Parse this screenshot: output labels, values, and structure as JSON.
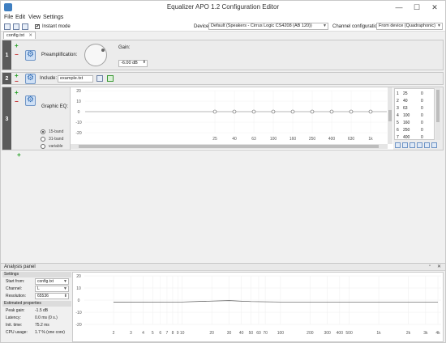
{
  "window": {
    "title": "Equalizer APO 1.2 Configuration Editor",
    "min": "—",
    "max": "☐",
    "close": "✕"
  },
  "menu": [
    "File",
    "Edit",
    "View",
    "Settings"
  ],
  "toolbar": {
    "instant_mode_label": "Instant mode",
    "instant_mode_checked": "✔",
    "device_label": "Device:",
    "device_value": "Default (Speakers - Cirrus Logic CS4208 (AB 120))",
    "channel_config_label": "Channel configuration:",
    "channel_config_value": "From device (Quadraphonic)"
  },
  "tab": {
    "label": "config.txt",
    "close": "✕"
  },
  "rows": [
    {
      "number": "1",
      "plus": "+",
      "minus": "−",
      "preamp_label": "Preamplification:",
      "gain_label": "Gain:",
      "gain_value": "-6.00 dB"
    },
    {
      "number": "2",
      "plus": "+",
      "minus": "−",
      "include_label": "Include:",
      "include_value": "example.txt"
    },
    {
      "number": "3",
      "plus": "+",
      "minus": "−",
      "eq_label": "Graphic EQ:"
    }
  ],
  "add_row": "+",
  "eq": {
    "y_ticks": [
      "20",
      "10",
      "0",
      "-10",
      "-20"
    ],
    "x_ticks": [
      "25",
      "40",
      "63",
      "100",
      "160",
      "250",
      "400",
      "630",
      "1k"
    ],
    "node_gains_db": [
      0,
      0,
      0,
      0,
      0,
      0,
      0,
      0,
      0
    ],
    "band_options": [
      "15-band",
      "31-band",
      "variable"
    ],
    "band_selected": "15-band",
    "table_rows": [
      {
        "n": "1",
        "f": "25",
        "g": "0"
      },
      {
        "n": "2",
        "f": "40",
        "g": "0"
      },
      {
        "n": "3",
        "f": "63",
        "g": "0"
      },
      {
        "n": "4",
        "f": "100",
        "g": "0"
      },
      {
        "n": "5",
        "f": "160",
        "g": "0"
      },
      {
        "n": "6",
        "f": "250",
        "g": "0"
      },
      {
        "n": "7",
        "f": "400",
        "g": "0"
      }
    ]
  },
  "analysis": {
    "title": "Analysis panel",
    "settings_header": "Settings",
    "start_from_label": "Start from:",
    "start_from_value": "config.txt",
    "channel_label": "Channel:",
    "channel_value": "L",
    "resolution_label": "Resolution:",
    "resolution_value": "65536",
    "estimated_header": "Estimated properties",
    "peak_gain_label": "Peak gain:",
    "peak_gain_value": "-1.5 dB",
    "latency_label": "Latency:",
    "latency_value": "0.0 ms (0 s.)",
    "init_time_label": "Init. time:",
    "init_time_value": "75.2 ms",
    "cpu_label": "CPU usage:",
    "cpu_value": "1.7 % (one core)",
    "y_ticks": [
      "20",
      "10",
      "0",
      "-10",
      "-20"
    ],
    "x_ticks": [
      "2",
      "3",
      "4",
      "5",
      "6",
      "7",
      "8",
      "9",
      "10",
      "20",
      "30",
      "40",
      "50",
      "60",
      "70",
      "100",
      "200",
      "300",
      "400",
      "500",
      "1k",
      "2k",
      "3k",
      "4k"
    ],
    "curve_points": [
      [
        2,
        -1.6
      ],
      [
        10,
        -1.5
      ],
      [
        20,
        -0.8
      ],
      [
        30,
        -0.4
      ],
      [
        50,
        -1.2
      ],
      [
        100,
        -1.5
      ],
      [
        1000,
        -1.5
      ],
      [
        4000,
        -1.5
      ]
    ]
  }
}
